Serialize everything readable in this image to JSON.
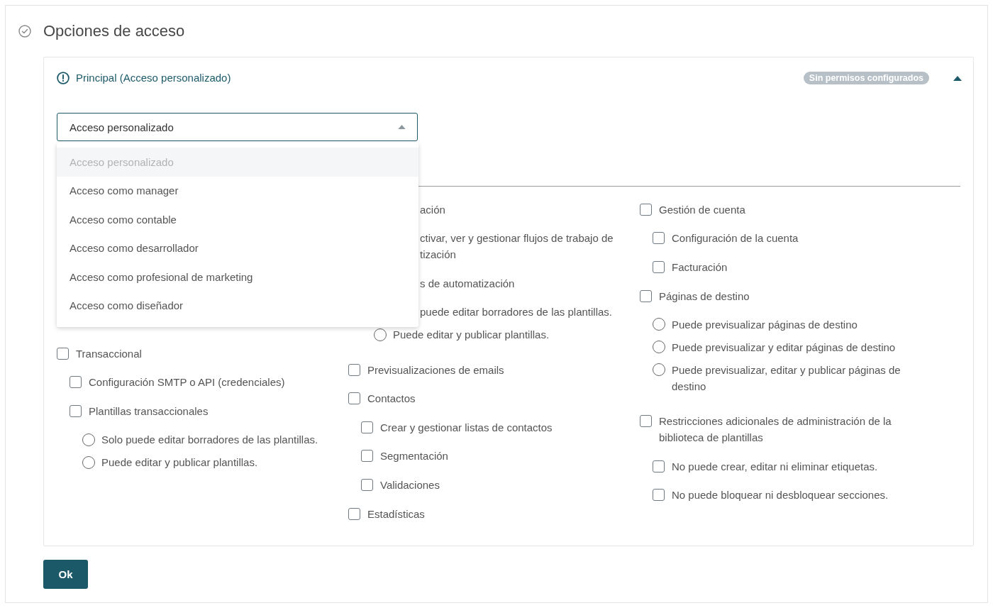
{
  "page": {
    "title": "Opciones de acceso"
  },
  "role_card": {
    "title": "Principal (Acceso personalizado)",
    "badge": "Sin permisos configurados",
    "expanded": true,
    "access_select": {
      "value": "Acceso personalizado",
      "expanded": true,
      "options": [
        {
          "label": "Acceso personalizado",
          "selected": true
        },
        {
          "label": "Acceso como manager",
          "selected": false
        },
        {
          "label": "Acceso como contable",
          "selected": false
        },
        {
          "label": "Acceso como desarrollador",
          "selected": false
        },
        {
          "label": "Acceso como profesional de marketing",
          "selected": false
        },
        {
          "label": "Acceso como diseñador",
          "selected": false
        }
      ]
    },
    "columns": [
      {
        "items": [
          {
            "kind": "checkbox",
            "label": "Transaccional",
            "checked": false,
            "children": [
              {
                "kind": "checkbox",
                "label": "Configuración SMTP o API (credenciales)",
                "checked": false
              },
              {
                "kind": "checkbox",
                "label": "Plantillas transaccionales",
                "checked": false,
                "children": [
                  {
                    "kind": "radio",
                    "label": "Solo puede editar borradores de las plantillas.",
                    "selected": false
                  },
                  {
                    "kind": "radio",
                    "label": "Puede editar y publicar plantillas.",
                    "selected": false
                  }
                ]
              }
            ]
          }
        ]
      },
      {
        "items": [
          {
            "kind": "checkbox",
            "covered": true,
            "label": "ación",
            "children": [
              {
                "kind": "checkbox",
                "covered": true,
                "lines": [
                  "ctivar, ver y gestionar flujos de trabajo de",
                  "tización"
                ]
              },
              {
                "kind": "checkbox",
                "covered": true,
                "label": "s de automatización",
                "children": [
                  {
                    "kind": "radio",
                    "covered": true,
                    "label": "puede editar borradores de las plantillas."
                  },
                  {
                    "kind": "radio",
                    "label": "Puede editar y publicar plantillas.",
                    "selected": false
                  }
                ]
              }
            ]
          },
          {
            "kind": "checkbox",
            "label": "Previsualizaciones de emails",
            "checked": false
          },
          {
            "kind": "checkbox",
            "label": "Contactos",
            "checked": false,
            "children": [
              {
                "kind": "checkbox",
                "label": "Crear y gestionar listas de contactos",
                "checked": false
              },
              {
                "kind": "checkbox",
                "label": "Segmentación",
                "checked": false
              },
              {
                "kind": "checkbox",
                "label": "Validaciones",
                "checked": false
              }
            ]
          },
          {
            "kind": "checkbox",
            "label": "Estadísticas",
            "checked": false
          }
        ]
      },
      {
        "items": [
          {
            "kind": "checkbox",
            "label": "Gestión de cuenta",
            "checked": false,
            "children": [
              {
                "kind": "checkbox",
                "label": "Configuración de la cuenta",
                "checked": false
              },
              {
                "kind": "checkbox",
                "label": "Facturación",
                "checked": false
              }
            ]
          },
          {
            "kind": "checkbox",
            "label": "Páginas de destino",
            "checked": false,
            "children": [
              {
                "kind": "radio",
                "label": "Puede previsualizar páginas de destino",
                "selected": false
              },
              {
                "kind": "radio",
                "label": "Puede previsualizar y editar páginas de destino",
                "selected": false
              },
              {
                "kind": "radio",
                "label": "Puede previsualizar, editar y publicar páginas de destino",
                "selected": false
              }
            ]
          },
          {
            "kind": "checkbox",
            "label": "Restricciones adicionales de administración de la biblioteca de plantillas",
            "checked": false,
            "children": [
              {
                "kind": "checkbox",
                "label": "No puede crear, editar ni eliminar etiquetas.",
                "checked": false
              },
              {
                "kind": "checkbox",
                "label": "No puede bloquear ni desbloquear secciones.",
                "checked": false
              }
            ]
          }
        ]
      }
    ]
  },
  "ok_button": {
    "label": "Ok"
  }
}
